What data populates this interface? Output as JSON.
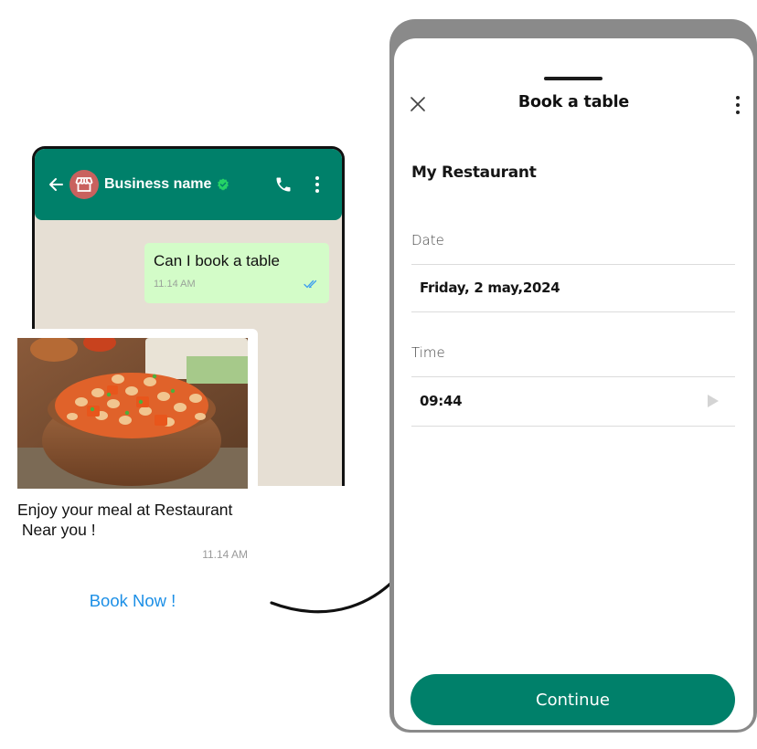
{
  "chat": {
    "header": {
      "business_name": "Business name",
      "verified": true,
      "brand_color": "#00806a",
      "avatar_color": "#c9615e"
    },
    "outgoing_message": {
      "text": "Can I book a table",
      "time": "11.14 AM",
      "status": "read"
    },
    "incoming_card": {
      "image": "food-bowl-beans-stew",
      "text": "Enjoy your meal at Restaurant\n Near you !",
      "time": "11.14 AM",
      "action_label": "Book Now !"
    }
  },
  "booking": {
    "title": "Book a table",
    "restaurant_name": "My Restaurant",
    "date_label": "Date",
    "date_value": "Friday, 2 may,2024",
    "time_label": "Time",
    "time_value": "09:44",
    "continue_label": "Continue",
    "accent_color": "#00806a"
  }
}
